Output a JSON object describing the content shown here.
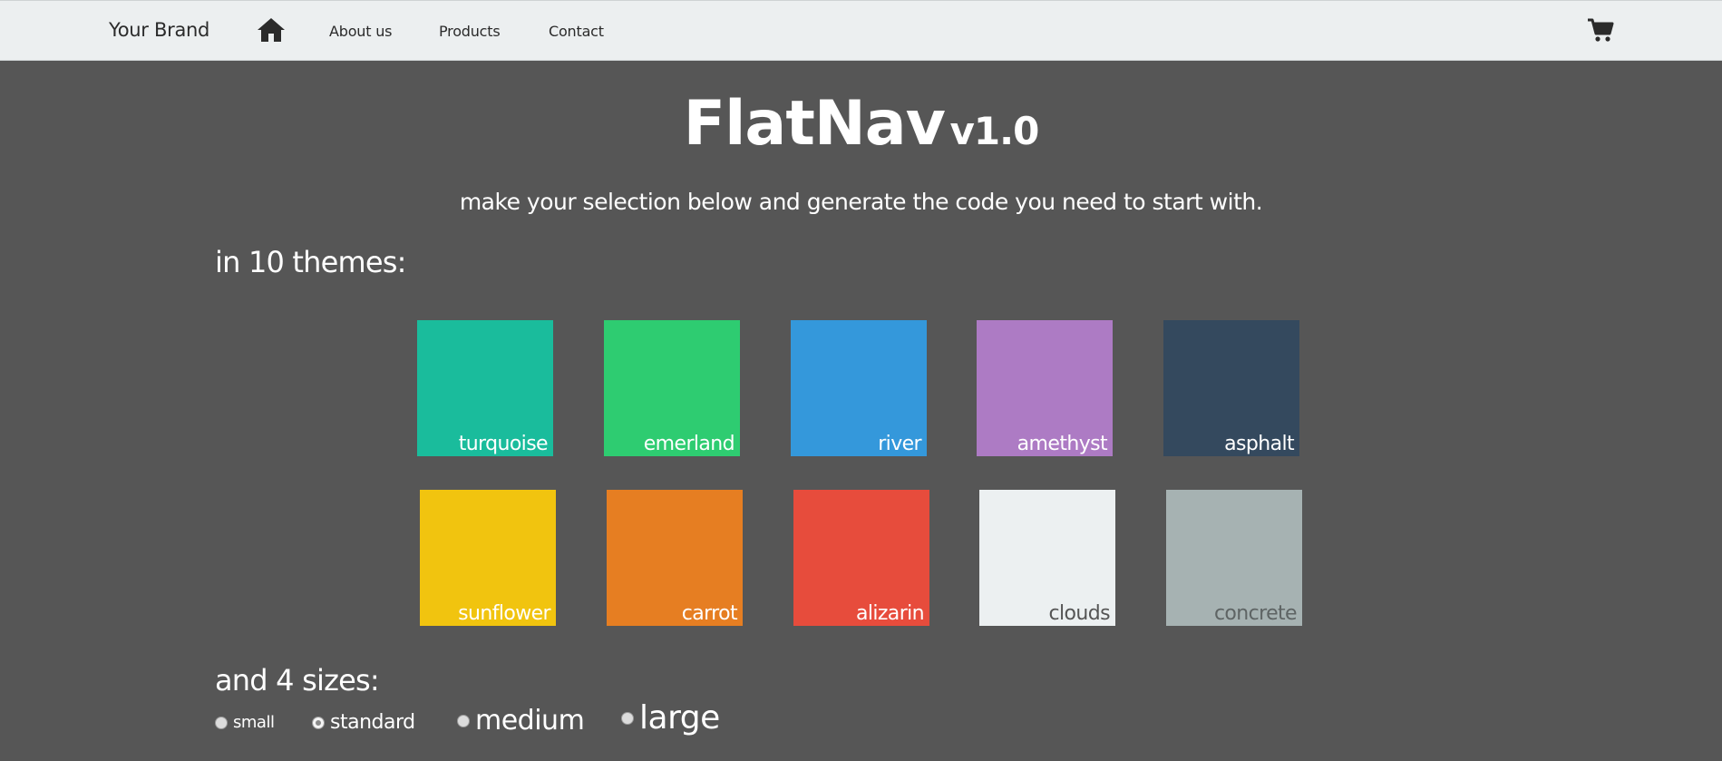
{
  "nav": {
    "brand": "Your Brand",
    "home_icon": "home-icon",
    "links": [
      "About us",
      "Products",
      "Contact"
    ],
    "cart_icon": "cart-icon"
  },
  "hero": {
    "title": "FlatNav",
    "version": "v1.0",
    "subtitle": "make your selection below and generate the code you need to start with."
  },
  "themes": {
    "heading": "in 10 themes:",
    "items": [
      {
        "label": "turquoise",
        "color": "#1abc9c",
        "text_color": "#ffffff"
      },
      {
        "label": "emerland",
        "color": "#2ecc71",
        "text_color": "#ffffff"
      },
      {
        "label": "river",
        "color": "#3498db",
        "text_color": "#ffffff"
      },
      {
        "label": "amethyst",
        "color": "#ad7bc4",
        "text_color": "#ffffff"
      },
      {
        "label": "asphalt",
        "color": "#34495e",
        "text_color": "#ffffff"
      },
      {
        "label": "sunflower",
        "color": "#f1c40f",
        "text_color": "#ffffff"
      },
      {
        "label": "carrot",
        "color": "#e67e22",
        "text_color": "#ffffff"
      },
      {
        "label": "alizarin",
        "color": "#e74c3c",
        "text_color": "#ffffff"
      },
      {
        "label": "clouds",
        "color": "#ecf0f1",
        "text_color": "#555555"
      },
      {
        "label": "concrete",
        "color": "#a6b2b2",
        "text_color": "#5e6464"
      }
    ]
  },
  "sizes": {
    "heading": "and 4 sizes:",
    "options": [
      {
        "label": "small",
        "checked": false
      },
      {
        "label": "standard",
        "checked": true
      },
      {
        "label": "medium",
        "checked": false
      },
      {
        "label": "large",
        "checked": false
      }
    ]
  }
}
